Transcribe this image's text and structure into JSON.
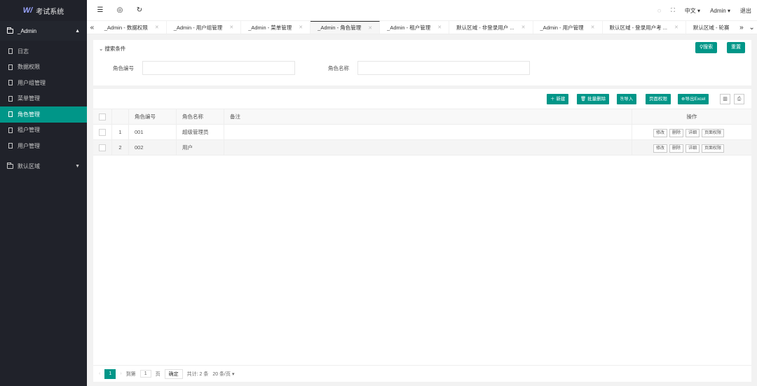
{
  "app": {
    "logo_mark": "W/",
    "title": "考试系统"
  },
  "sidebar": {
    "group": "_Admin",
    "items": [
      {
        "label": "日志"
      },
      {
        "label": "数据权限"
      },
      {
        "label": "用户组管理"
      },
      {
        "label": "菜单管理"
      },
      {
        "label": "角色管理",
        "active": true
      },
      {
        "label": "租户管理"
      },
      {
        "label": "用户管理"
      }
    ],
    "group2": "默认区域"
  },
  "header": {
    "icons": [
      "menu-fold-icon",
      "globe-icon",
      "refresh-icon"
    ],
    "lang": "中文",
    "user": "Admin",
    "logout": "退出"
  },
  "tabs": [
    {
      "label": "_Admin - 数据权限"
    },
    {
      "label": "_Admin - 用户组管理"
    },
    {
      "label": "_Admin - 菜单管理"
    },
    {
      "label": "_Admin - 角色管理",
      "active": true
    },
    {
      "label": "_Admin - 租户管理"
    },
    {
      "label": "默认区域 - 非登录用户 ..."
    },
    {
      "label": "_Admin - 用户管理"
    },
    {
      "label": "默认区域 - 登录用户考 ..."
    },
    {
      "label": "默认区域 - 轮赛"
    }
  ],
  "search": {
    "title": "搜索条件",
    "search_btn": "搜索",
    "reset_btn": "重置",
    "field1_label": "角色编号",
    "field2_label": "角色名称"
  },
  "toolbar": {
    "new": "新建",
    "batch_delete": "批量删除",
    "import": "导入",
    "page_perm": "页面权限",
    "export": "导出Excel"
  },
  "table": {
    "headers": [
      "角色编号",
      "角色名称",
      "备注",
      "操作"
    ],
    "rows": [
      {
        "no": "1",
        "code": "001",
        "name": "超级管理员",
        "remark": ""
      },
      {
        "no": "2",
        "code": "002",
        "name": "用户",
        "remark": ""
      }
    ],
    "actions": [
      "修改",
      "删除",
      "详细",
      "页面权限"
    ]
  },
  "pager": {
    "current": "1",
    "goto": "到第",
    "page_input": "1",
    "page_unit": "页",
    "confirm": "确定",
    "total": "共计: 2 条",
    "page_size": "20 条/页"
  },
  "colors": {
    "accent": "#009688",
    "sidebar": "#20222a"
  }
}
